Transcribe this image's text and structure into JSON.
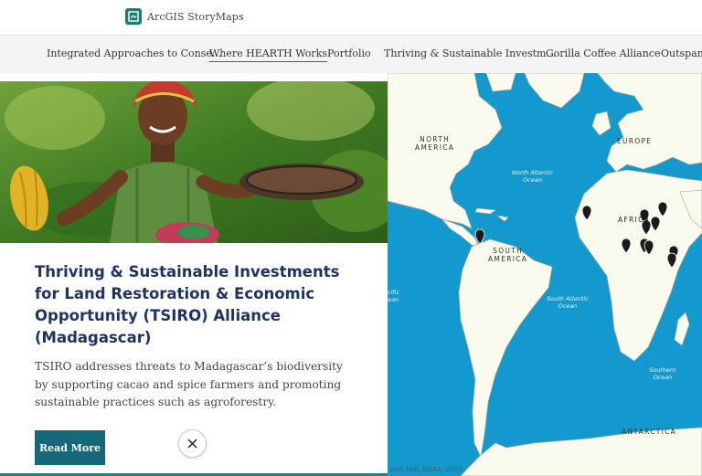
{
  "brand": {
    "name": "ArcGIS StoryMaps"
  },
  "nav": {
    "items": [
      {
        "label": "Integrated Approaches to Conse..."
      },
      {
        "label": "Where HEARTH Works"
      },
      {
        "label": "Portfolio"
      },
      {
        "label": "Thriving & Sustainable Investm..."
      },
      {
        "label": "Gorilla Coffee Alliance"
      },
      {
        "label": "Outspan"
      }
    ],
    "active_index": 1
  },
  "card": {
    "title": "Thriving & Sustainable Investments for Land Restoration & Economic Opportunity (TSIRO) Alliance (Madagascar)",
    "description": "TSIRO addresses threats to Madagascar’s biodiversity by supporting cacao and spice farmers and promoting sustainable practices such as agroforestry.",
    "button_label": "Read More"
  },
  "map": {
    "labels": {
      "north_america": "NORTH\nAMERICA",
      "europe": "EUROPE",
      "africa": "AFRICA",
      "south_america": "SOUTH\nAMERICA",
      "antarctica": "ANTARCTICA",
      "north_atlantic": "North Atlantic\nOcean",
      "south_atlantic": "South Atlantic\nOcean",
      "southern_ocean": "Southern\nOcean",
      "pacific_fragment": "cific\nean"
    },
    "attribution": "Esri, FAO, NOAA, USGS"
  },
  "colors": {
    "accent": "#14687a",
    "title": "#1e3366",
    "ocean": "#1499cf",
    "land": "#fbfaee"
  }
}
